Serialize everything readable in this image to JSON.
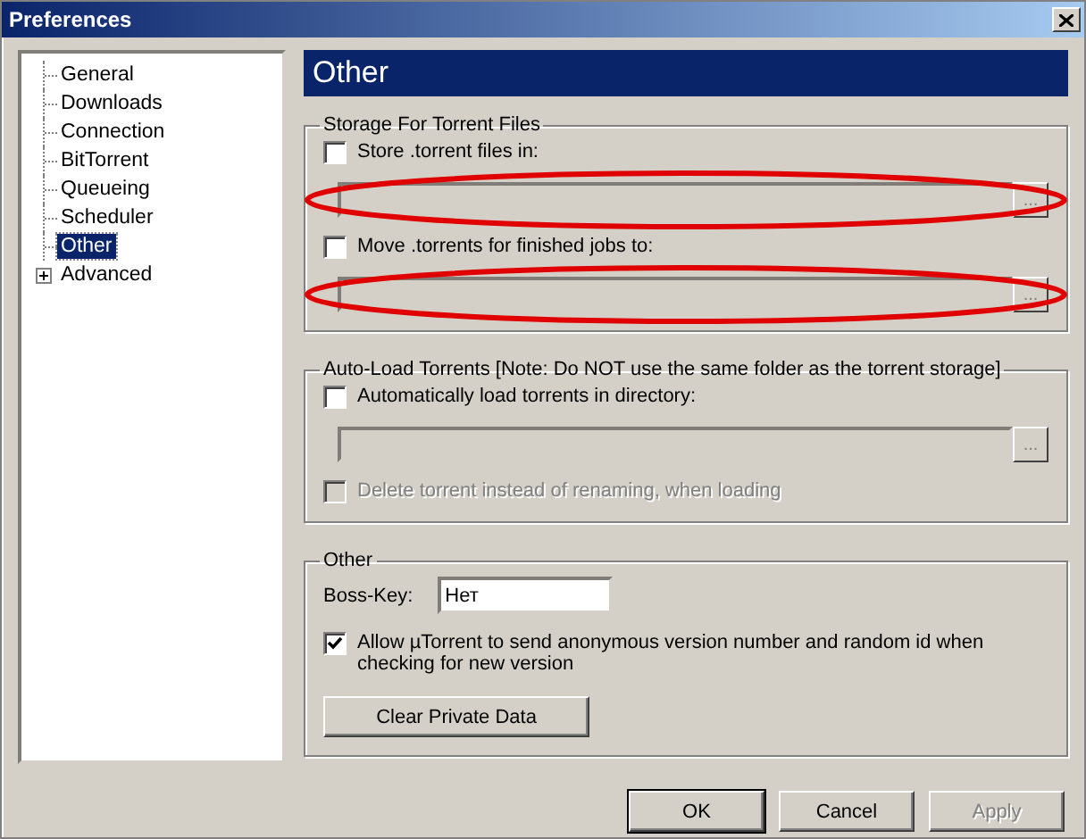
{
  "window": {
    "title": "Preferences"
  },
  "sidebar": {
    "items": [
      {
        "label": "General",
        "selected": false
      },
      {
        "label": "Downloads",
        "selected": false
      },
      {
        "label": "Connection",
        "selected": false
      },
      {
        "label": "BitTorrent",
        "selected": false
      },
      {
        "label": "Queueing",
        "selected": false
      },
      {
        "label": "Scheduler",
        "selected": false
      },
      {
        "label": "Other",
        "selected": true
      },
      {
        "label": "Advanced",
        "selected": false,
        "expanded": false
      }
    ]
  },
  "panel": {
    "title": "Other",
    "groups": [
      {
        "title": "Storage For Torrent Files",
        "items": [
          {
            "kind": "checkbox",
            "label": "Store .torrent files in:",
            "checked": false,
            "disabled": false
          },
          {
            "kind": "path",
            "browse_label": "...",
            "disabled": true,
            "highlighted": true
          },
          {
            "kind": "checkbox",
            "label": "Move .torrents for finished jobs to:",
            "checked": false,
            "disabled": false
          },
          {
            "kind": "path",
            "browse_label": "...",
            "disabled": true,
            "highlighted": true
          }
        ]
      },
      {
        "title": "Auto-Load Torrents [Note: Do NOT use the same folder as the torrent storage]",
        "items": [
          {
            "kind": "checkbox",
            "label": "Automatically load torrents in directory:",
            "checked": false,
            "disabled": false
          },
          {
            "kind": "path",
            "browse_label": "...",
            "disabled": true,
            "highlighted": false
          },
          {
            "kind": "checkbox",
            "label": "Delete torrent instead of renaming, when loading",
            "checked": false,
            "disabled": true
          }
        ]
      },
      {
        "title": "Other",
        "items": [
          {
            "kind": "field",
            "label": "Boss-Key:",
            "value": "Нет"
          },
          {
            "kind": "checkbox",
            "label": "Allow µTorrent to send anonymous version number and random id when checking for new version",
            "checked": true,
            "disabled": false
          },
          {
            "kind": "button",
            "label": "Clear Private Data"
          }
        ]
      }
    ]
  },
  "buttons": [
    {
      "label": "OK",
      "default": true,
      "disabled": false
    },
    {
      "label": "Cancel",
      "default": false,
      "disabled": false
    },
    {
      "label": "Apply",
      "default": false,
      "disabled": true
    }
  ]
}
